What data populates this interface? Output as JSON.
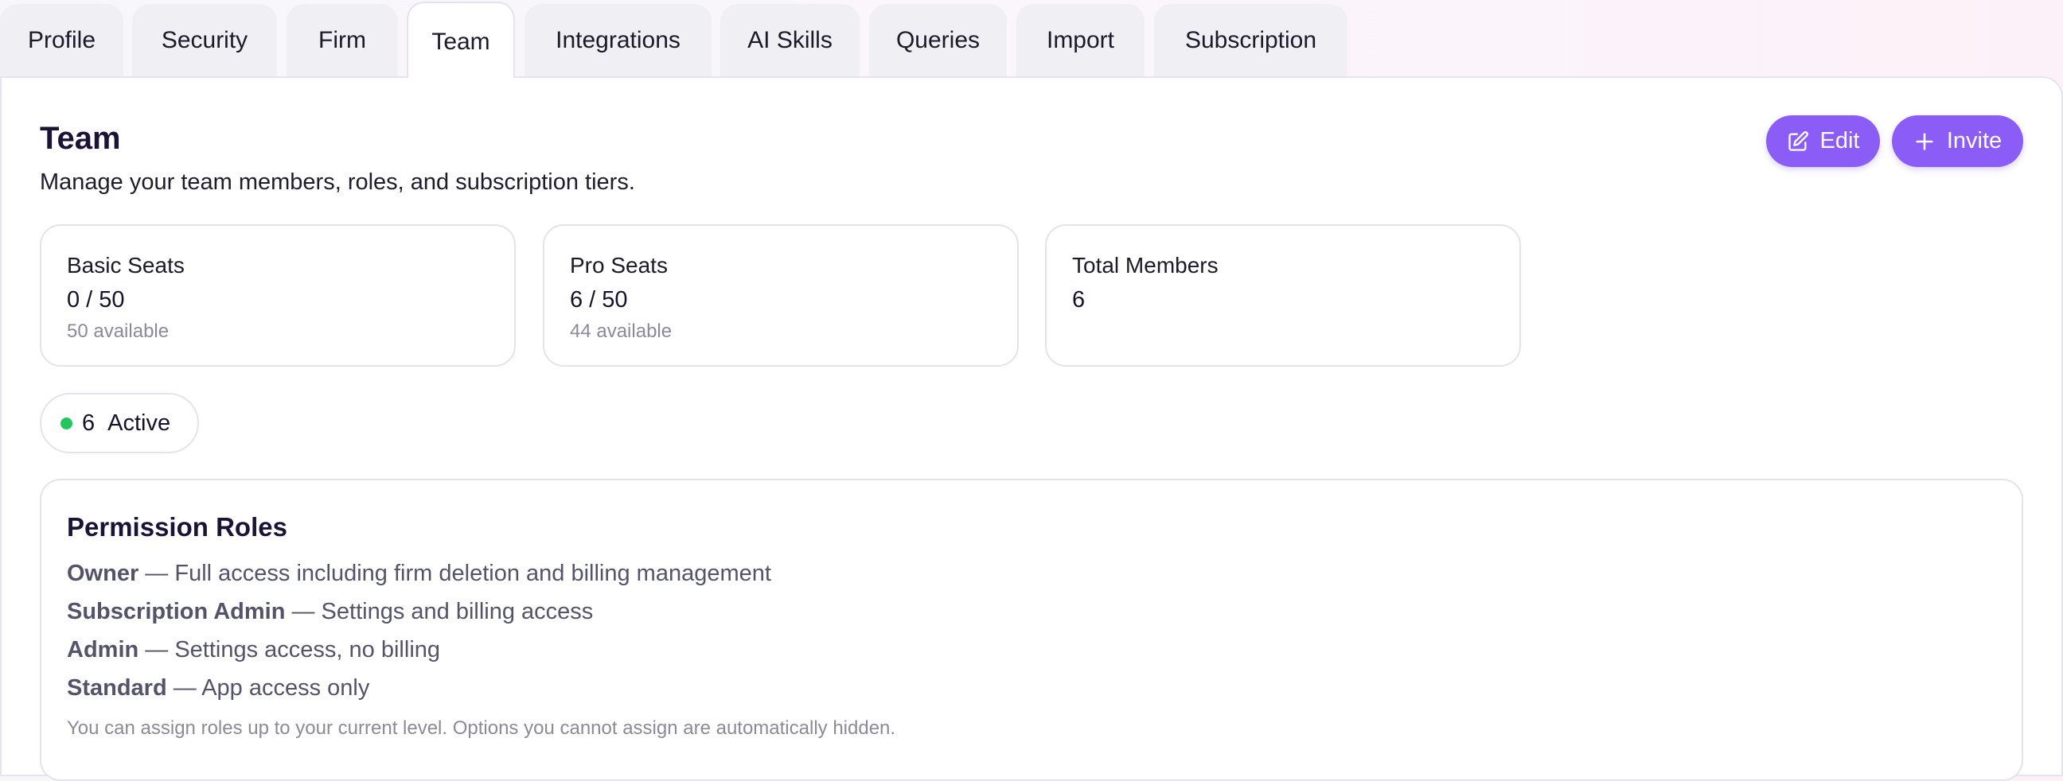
{
  "tabs": [
    {
      "label": "Profile",
      "active": false
    },
    {
      "label": "Security",
      "active": false
    },
    {
      "label": "Firm",
      "active": false
    },
    {
      "label": "Team",
      "active": true
    },
    {
      "label": "Integrations",
      "active": false
    },
    {
      "label": "AI Skills",
      "active": false
    },
    {
      "label": "Queries",
      "active": false
    },
    {
      "label": "Import",
      "active": false
    },
    {
      "label": "Subscription",
      "active": false
    }
  ],
  "page": {
    "title": "Team",
    "subtitle": "Manage your team members, roles, and subscription tiers."
  },
  "actions": {
    "edit_label": "Edit",
    "edit_icon": "edit-icon",
    "invite_label": "Invite",
    "invite_icon": "plus-icon",
    "accent_color": "#8b5cf6"
  },
  "stats": [
    {
      "label": "Basic Seats",
      "value": "0 / 50",
      "available": "50 available"
    },
    {
      "label": "Pro Seats",
      "value": "6 / 50",
      "available": "44 available"
    },
    {
      "label": "Total Members",
      "value": "6",
      "available": ""
    }
  ],
  "status": {
    "count": "6",
    "label": "Active",
    "color": "#22c55e"
  },
  "permission_roles": {
    "heading": "Permission Roles",
    "roles": [
      {
        "name": "Owner",
        "description": " — Full access including firm deletion and billing management"
      },
      {
        "name": "Subscription Admin",
        "description": " — Settings and billing access"
      },
      {
        "name": "Admin",
        "description": " — Settings access, no billing"
      },
      {
        "name": "Standard",
        "description": " — App access only"
      }
    ],
    "note": "You can assign roles up to your current level. Options you cannot assign are automatically hidden."
  }
}
